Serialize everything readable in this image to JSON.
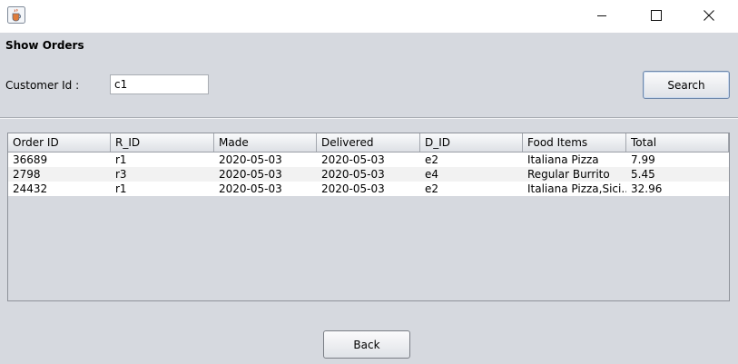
{
  "window": {
    "icons": {
      "app": "java-coffee-cup-icon",
      "minimize": "minimize-icon",
      "maximize": "maximize-icon",
      "close": "close-icon"
    }
  },
  "heading": "Show Orders",
  "search": {
    "customer_label": "Customer Id :",
    "customer_value": "c1",
    "search_label": "Search"
  },
  "table": {
    "columns": [
      "Order ID",
      "R_ID",
      "Made",
      "Delivered",
      "D_ID",
      "Food Items",
      "Total"
    ],
    "rows": [
      [
        "36689",
        "r1",
        "2020-05-03",
        "2020-05-03",
        "e2",
        "Italiana Pizza",
        "7.99"
      ],
      [
        "2798",
        "r3",
        "2020-05-03",
        "2020-05-03",
        "e4",
        "Regular Burrito",
        "5.45"
      ],
      [
        "24432",
        "r1",
        "2020-05-03",
        "2020-05-03",
        "e2",
        "Italiana Pizza,Sici...",
        "32.96"
      ]
    ]
  },
  "footer": {
    "back_label": "Back"
  }
}
